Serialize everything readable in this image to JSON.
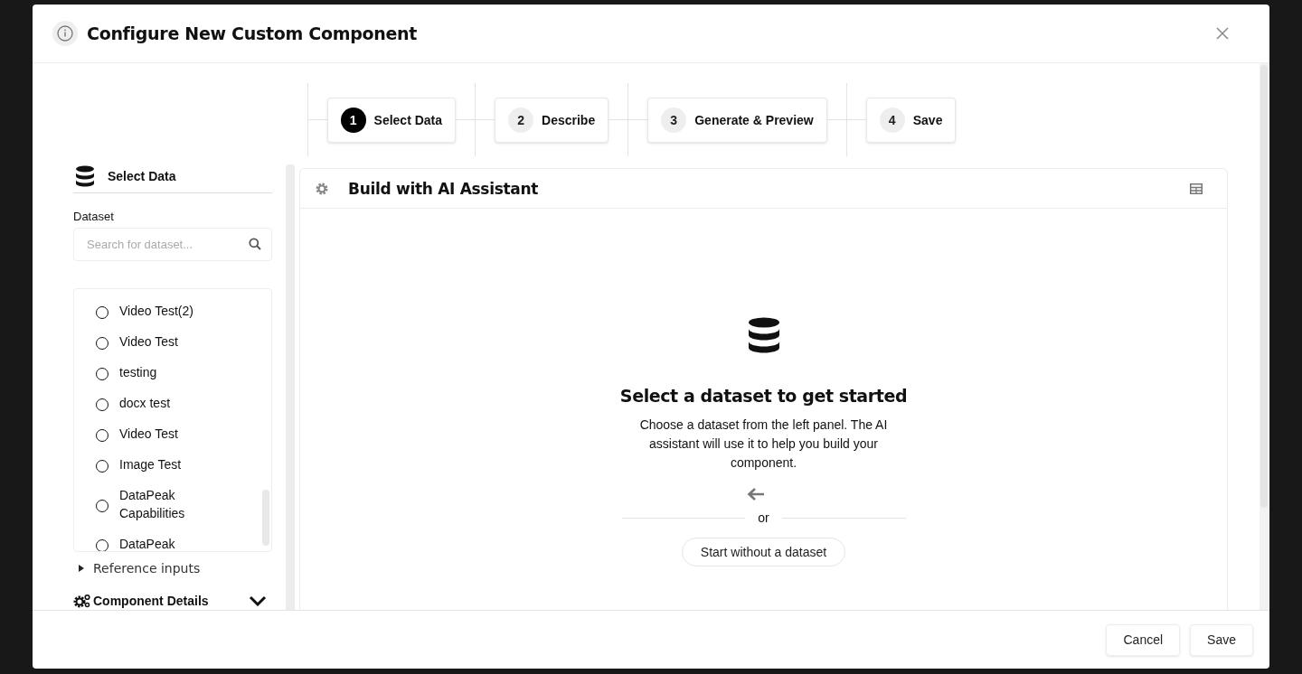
{
  "dialog": {
    "title": "Configure New Custom Component"
  },
  "steps": [
    {
      "number": "1",
      "label": "Select Data",
      "selected": true
    },
    {
      "number": "2",
      "label": "Describe",
      "selected": false
    },
    {
      "number": "3",
      "label": "Generate & Preview",
      "selected": false
    },
    {
      "number": "4",
      "label": "Save",
      "selected": false
    }
  ],
  "left_panel": {
    "title": "Select Data",
    "dataset_label": "Dataset",
    "search": {
      "placeholder": "Search for dataset..."
    },
    "datasets": [
      {
        "label": "Video Test(2)",
        "selected": false
      },
      {
        "label": "Video Test",
        "selected": false
      },
      {
        "label": "testing",
        "selected": false
      },
      {
        "label": "docx test",
        "selected": false
      },
      {
        "label": "Video Test",
        "selected": false
      },
      {
        "label": "Image Test",
        "selected": false
      },
      {
        "label": "DataPeak Capabilities",
        "selected": false
      },
      {
        "label": "DataPeak",
        "selected": false
      }
    ],
    "reference_inputs": {
      "label": "Reference inputs",
      "expanded": false
    },
    "component_details": {
      "label": "Component Details"
    }
  },
  "main_panel": {
    "title": "Build with AI Assistant",
    "empty_state": {
      "heading": "Select a dataset to get started",
      "text": "Choose a dataset from the left panel. The AI assistant will use it to help you build your component.",
      "divider_text": "or",
      "button": "Start without a dataset"
    }
  },
  "footer": {
    "buttons": [
      "Cancel",
      "Save"
    ]
  }
}
